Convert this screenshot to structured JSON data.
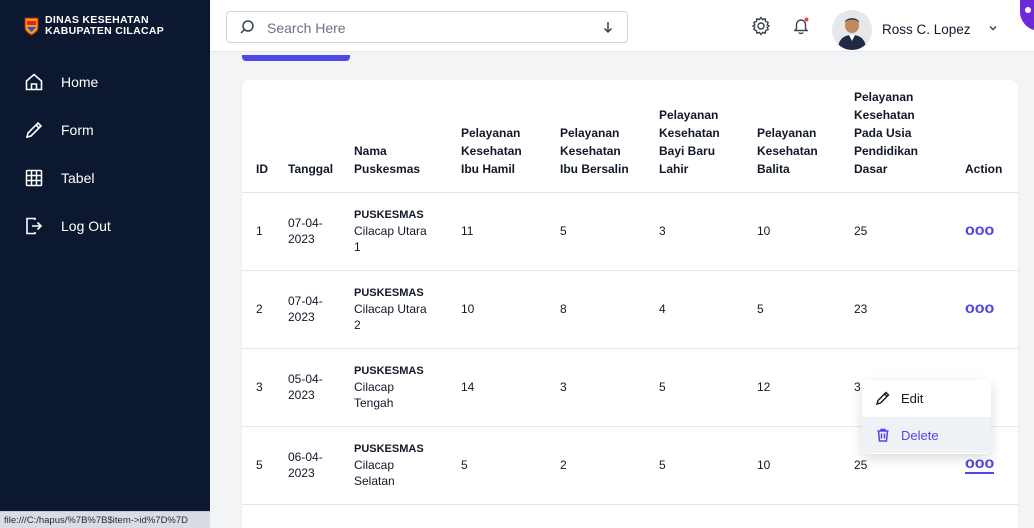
{
  "brand": {
    "line1": "DINAS KESEHATAN",
    "line2": "KABUPATEN CILACAP"
  },
  "sidebar": {
    "items": [
      {
        "label": "Home",
        "icon": "home-icon"
      },
      {
        "label": "Form",
        "icon": "pencil-icon"
      },
      {
        "label": "Tabel",
        "icon": "table-icon"
      },
      {
        "label": "Log Out",
        "icon": "logout-icon"
      }
    ]
  },
  "status_bar": {
    "url": "file:///C:/hapus/%7B%7B$item->id%7D%7D"
  },
  "header": {
    "search_placeholder": "Search Here",
    "user_name": "Ross C. Lopez"
  },
  "table": {
    "headers": {
      "id": "ID",
      "tanggal": "Tanggal",
      "nama_1": "Nama",
      "nama_2": "Puskesmas",
      "hamil_1": "Pelayanan",
      "hamil_2": "Kesehatan",
      "hamil_3": "Ibu Hamil",
      "bersalin_1": "Pelayanan",
      "bersalin_2": "Kesehatan",
      "bersalin_3": "Ibu Bersalin",
      "bayi_1": "Pelayanan",
      "bayi_2": "Kesehatan",
      "bayi_3": "Bayi Baru",
      "bayi_4": "Lahir",
      "balita_1": "Pelayanan",
      "balita_2": "Kesehatan",
      "balita_3": "Balita",
      "sd_1": "Pelayanan",
      "sd_2": "Kesehatan",
      "sd_3": "Pada Usia",
      "sd_4": "Pendidikan",
      "sd_5": "Dasar",
      "action": "Action"
    },
    "rows": [
      {
        "id": "1",
        "date_1": "07-04-",
        "date_2": "2023",
        "name_1": "PUSKESMAS",
        "name_2": "Cilacap Utara",
        "name_3": "1",
        "hamil": "11",
        "bersalin": "5",
        "bayi": "3",
        "balita": "10",
        "sd": "25",
        "action": "ooo"
      },
      {
        "id": "2",
        "date_1": "07-04-",
        "date_2": "2023",
        "name_1": "PUSKESMAS",
        "name_2": "Cilacap Utara",
        "name_3": "2",
        "hamil": "10",
        "bersalin": "8",
        "bayi": "4",
        "balita": "5",
        "sd": "23",
        "action": "ooo"
      },
      {
        "id": "3",
        "date_1": "05-04-",
        "date_2": "2023",
        "name_1": "PUSKESMAS",
        "name_2": "Cilacap",
        "name_3": "Tengah",
        "hamil": "14",
        "bersalin": "3",
        "bayi": "5",
        "balita": "12",
        "sd": "3",
        "action": ""
      },
      {
        "id": "5",
        "date_1": "06-04-",
        "date_2": "2023",
        "name_1": "PUSKESMAS",
        "name_2": "Cilacap",
        "name_3": "Selatan",
        "hamil": "5",
        "bersalin": "2",
        "bayi": "5",
        "balita": "10",
        "sd": "25",
        "action": "ooo"
      }
    ]
  },
  "dropdown": {
    "edit_label": "Edit",
    "delete_label": "Delete"
  },
  "colors": {
    "sidebar_bg": "#0c1830",
    "accent": "#4f46e5"
  }
}
